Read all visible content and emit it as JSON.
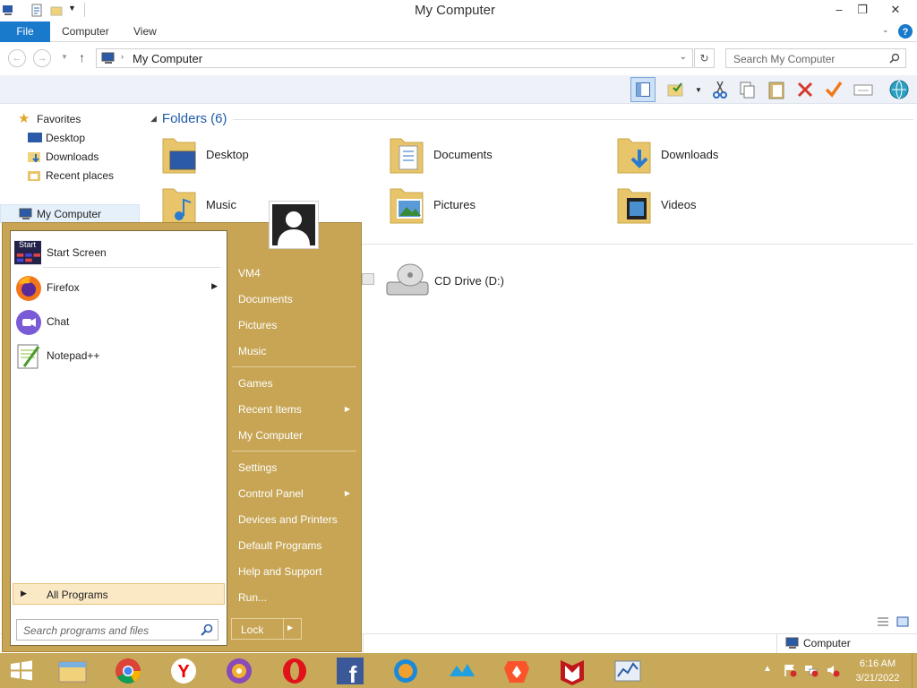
{
  "window": {
    "title": "My Computer"
  },
  "ribbon": {
    "tabs": [
      "File",
      "Computer",
      "View"
    ]
  },
  "address": {
    "location": "My Computer",
    "search_placeholder": "Search My Computer"
  },
  "nav": {
    "favorites_label": "Favorites",
    "favorites": [
      "Desktop",
      "Downloads",
      "Recent places"
    ],
    "computer_label": "My Computer"
  },
  "content": {
    "folders_header": "Folders (6)",
    "folders": [
      "Desktop",
      "Documents",
      "Downloads",
      "Music",
      "Pictures",
      "Videos"
    ],
    "drive": "CD Drive (D:)"
  },
  "status": {
    "location": "Computer"
  },
  "startmenu": {
    "pinned": [
      "Start Screen",
      "Firefox",
      "Chat",
      "Notepad++"
    ],
    "start_icon_text": "Start",
    "all_programs": "All Programs",
    "search_placeholder": "Search programs and files",
    "right_items": {
      "user": "VM4",
      "documents": "Documents",
      "pictures": "Pictures",
      "music": "Music",
      "games": "Games",
      "recent": "Recent Items",
      "computer": "My Computer",
      "settings": "Settings",
      "control": "Control Panel",
      "devices": "Devices and Printers",
      "defaults": "Default Programs",
      "help": "Help and Support",
      "run": "Run..."
    },
    "lock": "Lock"
  },
  "taskbar": {
    "time": "6:16 AM",
    "date": "3/21/2022"
  },
  "colors": {
    "accent": "#1979ca",
    "startmenu": "#c7a554",
    "taskbar": "#c8a859",
    "folder_header": "#1e5aa8"
  }
}
